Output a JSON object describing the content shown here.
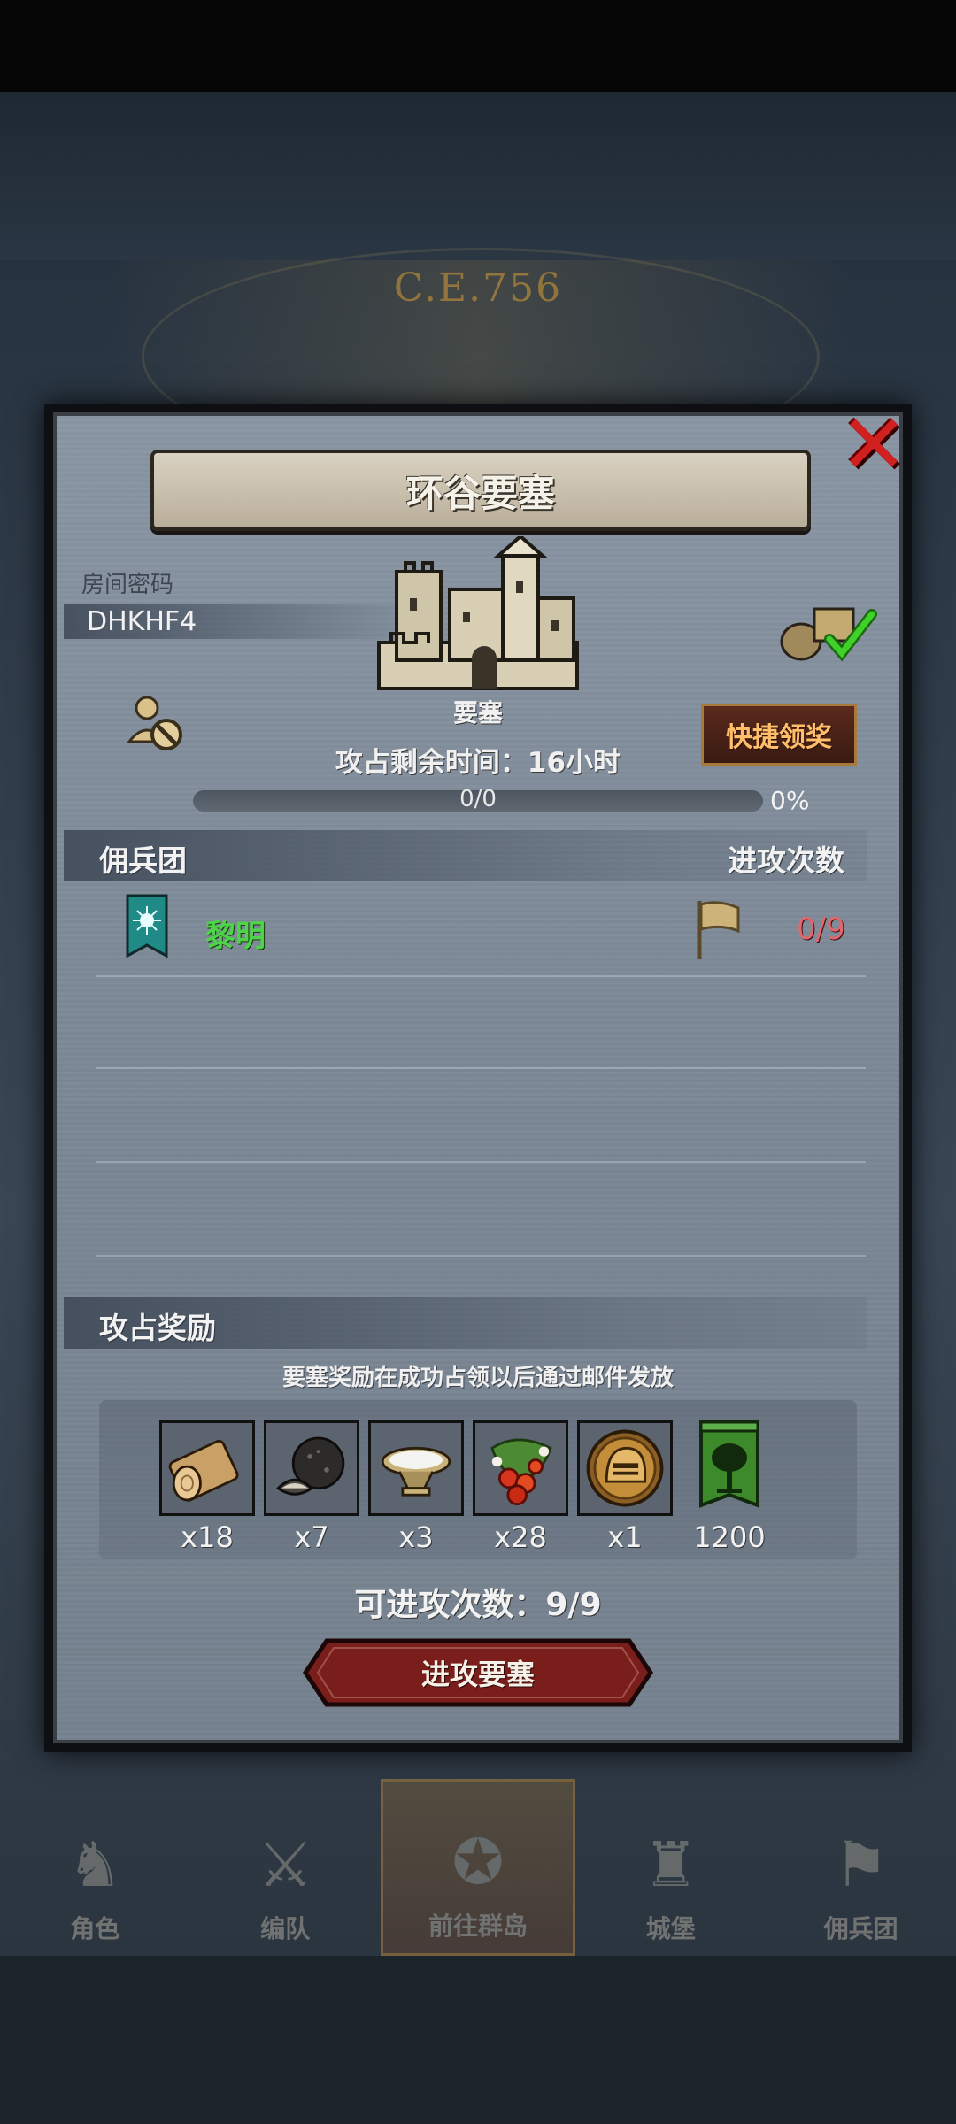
{
  "background": {
    "era_label": "C.E.756"
  },
  "dialog": {
    "title": "环谷要塞",
    "room_code_label": "房间密码",
    "room_code": "DHKHF4",
    "fortress_label": "要塞",
    "quick_claim_label": "快捷领奖",
    "time_remaining_prefix": "攻占剩余时间：",
    "time_remaining_value": "16小时",
    "progress_text": "0/0",
    "progress_percent": "0%",
    "progress_fraction": 0
  },
  "mercenary_section": {
    "title": "佣兵团",
    "attacks_header": "进攻次数",
    "guilds": [
      {
        "name": "黎明",
        "attacks": "0/9"
      }
    ]
  },
  "rewards_section": {
    "title": "攻占奖励",
    "note": "要塞奖励在成功占领以后通过邮件发放",
    "items": [
      {
        "icon": "wood-log-icon",
        "qty": "x18"
      },
      {
        "icon": "truffle-icon",
        "qty": "x7"
      },
      {
        "icon": "salt-bowl-icon",
        "qty": "x3"
      },
      {
        "icon": "berries-icon",
        "qty": "x28"
      },
      {
        "icon": "helmet-coin-icon",
        "qty": "x1"
      },
      {
        "icon": "guild-tree-banner-icon",
        "qty": "1200"
      }
    ]
  },
  "attacks_available_label": "可进攻次数：9/9",
  "attack_button_label": "进攻要塞",
  "bottom_nav": {
    "items": [
      {
        "label": "角色",
        "active": false
      },
      {
        "label": "编队",
        "active": false
      },
      {
        "label": "前往群岛",
        "active": true
      },
      {
        "label": "城堡",
        "active": false
      },
      {
        "label": "佣兵团",
        "active": false
      }
    ]
  },
  "colors": {
    "panel": "#7f8b99",
    "guild_name": "#4fd34a",
    "attack_count": "#e0676b",
    "quick_claim_text": "#ffbe6a",
    "close_x": "#d0201f"
  }
}
